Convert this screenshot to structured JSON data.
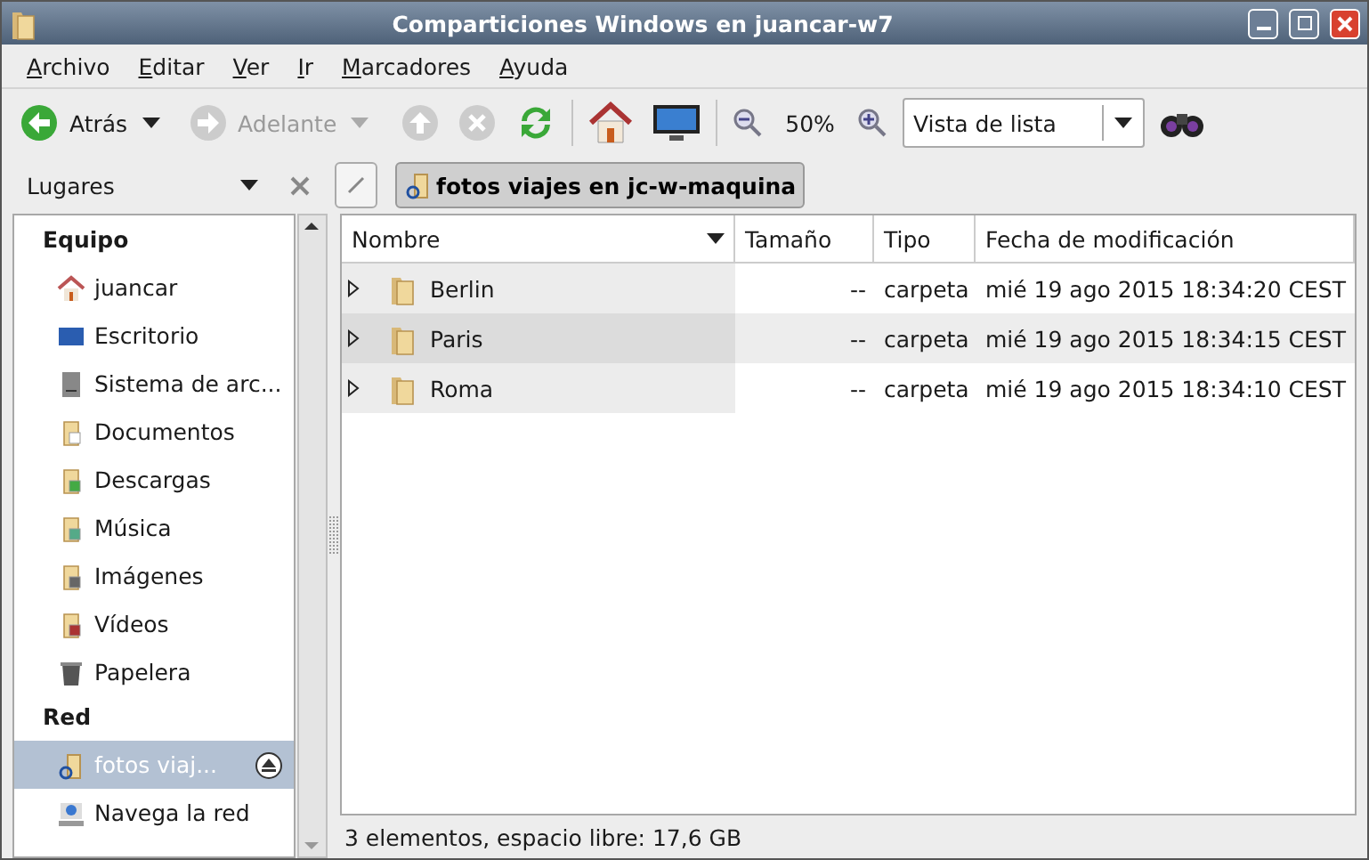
{
  "window": {
    "title": "Comparticiones Windows en juancar-w7"
  },
  "menu": [
    "Archivo",
    "Editar",
    "Ver",
    "Ir",
    "Marcadores",
    "Ayuda"
  ],
  "toolbar": {
    "back": {
      "label": "Atrás",
      "disabled": false
    },
    "forward": {
      "label": "Adelante",
      "disabled": true
    },
    "up_disabled": true,
    "stop_disabled": true,
    "zoom": "50%",
    "view": "Vista de lista"
  },
  "sidebar": {
    "title": "Lugares",
    "sections": [
      {
        "title": "Equipo",
        "items": [
          {
            "label": "juancar",
            "kind": "home",
            "selected": false
          },
          {
            "label": "Escritorio",
            "kind": "desktop",
            "selected": false
          },
          {
            "label": "Sistema de arc...",
            "kind": "drive",
            "selected": false
          },
          {
            "label": "Documentos",
            "kind": "documents",
            "selected": false
          },
          {
            "label": "Descargas",
            "kind": "downloads",
            "selected": false
          },
          {
            "label": "Música",
            "kind": "music",
            "selected": false
          },
          {
            "label": "Imágenes",
            "kind": "pictures",
            "selected": false
          },
          {
            "label": "Vídeos",
            "kind": "videos",
            "selected": false
          },
          {
            "label": "Papelera",
            "kind": "trash",
            "selected": false
          }
        ]
      },
      {
        "title": "Red",
        "items": [
          {
            "label": "fotos viaj...",
            "kind": "share",
            "selected": true
          },
          {
            "label": "Navega la red",
            "kind": "network",
            "selected": false
          }
        ]
      }
    ]
  },
  "location": {
    "path": "fotos viajes en jc-w-maquina"
  },
  "table": {
    "columns": [
      "Nombre",
      "Tamaño",
      "Tipo",
      "Fecha de modificación"
    ],
    "rows": [
      {
        "name": "Berlin",
        "size": "--",
        "type": "carpeta",
        "date": "mié 19 ago 2015 18:34:20 CEST"
      },
      {
        "name": "Paris",
        "size": "--",
        "type": "carpeta",
        "date": "mié 19 ago 2015 18:34:15 CEST"
      },
      {
        "name": "Roma",
        "size": "--",
        "type": "carpeta",
        "date": "mié 19 ago 2015 18:34:10 CEST"
      }
    ]
  },
  "status_bar": "3 elementos, espacio libre: 17,6 GB"
}
